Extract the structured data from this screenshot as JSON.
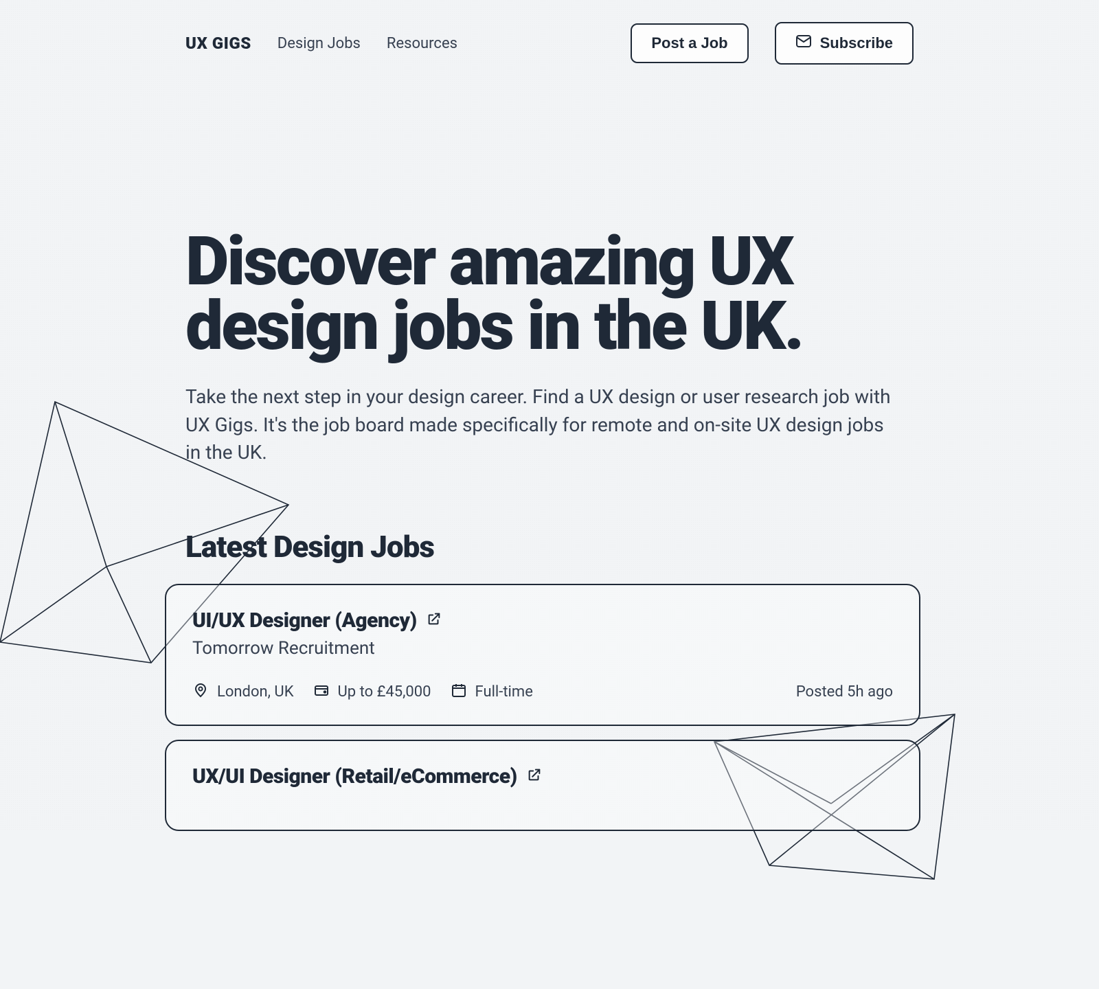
{
  "header": {
    "logo": "UX GIGS",
    "nav": [
      {
        "label": "Design Jobs"
      },
      {
        "label": "Resources"
      }
    ],
    "post_label": "Post a Job",
    "subscribe_label": "Subscribe"
  },
  "hero": {
    "title": "Discover amazing UX design jobs in the UK.",
    "subtitle": "Take the next step in your design career. Find a UX design or user research job with UX Gigs. It's the job board made specifically for remote and on-site UX design jobs in the UK."
  },
  "section_title": "Latest Design Jobs",
  "jobs": [
    {
      "title": "UI/UX Designer (Agency)",
      "company": "Tomorrow Recruitment",
      "location": "London, UK",
      "salary": "Up to £45,000",
      "type": "Full-time",
      "posted": "Posted 5h ago"
    },
    {
      "title": "UX/UI Designer (Retail/eCommerce)",
      "company": "",
      "location": "",
      "salary": "",
      "type": "",
      "posted": ""
    }
  ]
}
